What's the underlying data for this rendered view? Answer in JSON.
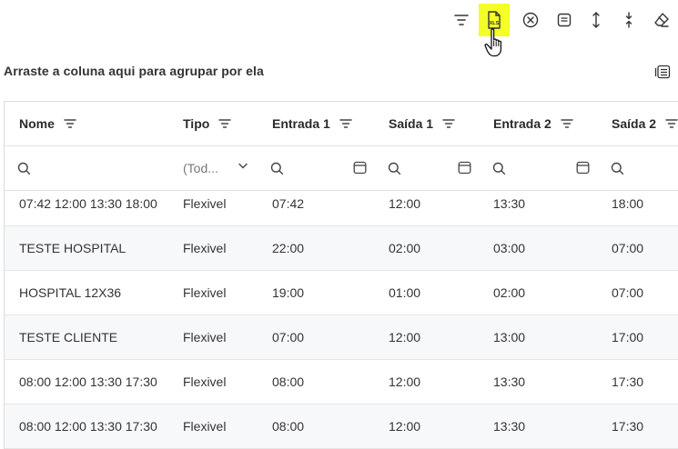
{
  "toolbar": {
    "buttons": [
      {
        "name": "filter-icon"
      },
      {
        "name": "export-xls-icon",
        "label": "XLS",
        "active": true
      },
      {
        "name": "clear-circle-icon"
      },
      {
        "name": "panel-icon"
      },
      {
        "name": "expand-vertical-icon"
      },
      {
        "name": "collapse-vertical-icon"
      },
      {
        "name": "eraser-icon"
      }
    ],
    "accent_color": "#f4ff28"
  },
  "group_panel": {
    "text": "Arraste a coluna aqui para agrupar por ela"
  },
  "columns": [
    "Nome",
    "Tipo",
    "Entrada 1",
    "Saída 1",
    "Entrada 2",
    "Saída 2"
  ],
  "filters": {
    "tipo_select": "(Tod..."
  },
  "rows": [
    [
      "07:42 12:00 13:30 18:00",
      "Flexivel",
      "07:42",
      "12:00",
      "13:30",
      "18:00"
    ],
    [
      "TESTE HOSPITAL",
      "Flexivel",
      "22:00",
      "02:00",
      "03:00",
      "07:00"
    ],
    [
      "HOSPITAL 12X36",
      "Flexivel",
      "19:00",
      "01:00",
      "02:00",
      "07:00"
    ],
    [
      "TESTE CLIENTE",
      "Flexivel",
      "07:00",
      "12:00",
      "13:00",
      "17:00"
    ],
    [
      "08:00 12:00 13:30 17:30",
      "Flexivel",
      "08:00",
      "12:00",
      "13:30",
      "17:30"
    ],
    [
      "08:00 12:00 13:30 17:30",
      "Flexivel",
      "08:00",
      "12:00",
      "13:30",
      "17:30"
    ]
  ]
}
